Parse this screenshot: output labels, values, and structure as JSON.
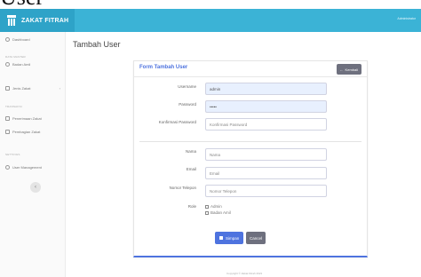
{
  "page_heading": "User",
  "app": {
    "brand": "ZAKAT FITRAH",
    "user_name": "Administrator"
  },
  "sidebar": {
    "dashboard": "Dashboard",
    "section_master": "DATA MASTER",
    "badan_amil": "Badan Amil",
    "jenis_zakat": "Jenis Zakat",
    "section_transaksi": "TRANSAKSI",
    "penerimaan": "Penerimaan Zakat",
    "pembagian": "Pembagian Zakat",
    "section_settings": "SETTINGS",
    "user_management": "User Management",
    "toggle": "‹"
  },
  "content": {
    "title": "Tambah User"
  },
  "form": {
    "title": "Form Tambah User",
    "back_label": "Kembali",
    "username": {
      "label": "Username",
      "value": "admin"
    },
    "password": {
      "label": "Password",
      "value": "•••••"
    },
    "konfirmasi": {
      "label": "Konfirmasi Password",
      "placeholder": "Konfirmasi Password"
    },
    "nama": {
      "label": "Nama",
      "placeholder": "Nama"
    },
    "email": {
      "label": "Email",
      "placeholder": "Email"
    },
    "telepon": {
      "label": "Nomor Telepon",
      "placeholder": "Nomor Telepon"
    },
    "role": {
      "label": "Role",
      "options": [
        "Admin",
        "Badan Amil"
      ]
    },
    "save_label": "Simpan",
    "cancel_label": "Cancel"
  },
  "footer": "Copyright © Zakat Fitrah 2021"
}
